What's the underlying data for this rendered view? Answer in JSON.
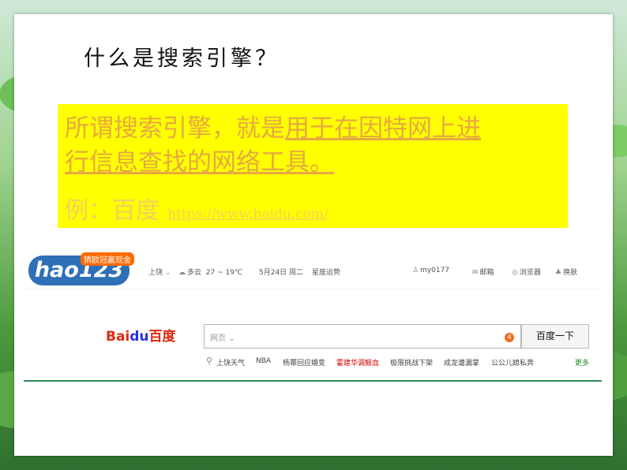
{
  "slide": {
    "title": "什么是搜索引擎？",
    "definition_plain": "所谓搜索引擎，就是",
    "definition_underlined_1": "用于在因特网上进",
    "definition_underlined_2": "行信息查找的网络工具。",
    "example_label": "例：百度",
    "example_url": "https://www.baidu.com/"
  },
  "screenshot": {
    "hao_logo": "hao123",
    "hao_badge": "猜欧冠赢现金",
    "city": "上饶",
    "weather": "多云",
    "temperature": "27 ~ 19℃",
    "date": "5月24日 周二",
    "horoscope": "星座运势",
    "user": "my0177",
    "mail": "邮箱",
    "browser": "浏览器",
    "skin": "换肤",
    "baidu_logo_en": "Bai",
    "baidu_logo_paw": "du",
    "baidu_logo_cn": "百度",
    "search_type": "网页",
    "search_badge": "4",
    "search_button": "百度一下",
    "hot_searches": [
      "上饶天气",
      "NBA",
      "杨幂回应婚变",
      "霍建华调鲸血",
      "极限挑战下架",
      "成龙遭漏掌",
      "公公儿媳私奔"
    ],
    "more": "更多"
  },
  "colors": {
    "definition_bg": "#ffff00",
    "definition_text": "#e7a940",
    "baidu_red": "#de2910",
    "baidu_blue": "#2932e1",
    "divider_green": "#2e8b57"
  }
}
